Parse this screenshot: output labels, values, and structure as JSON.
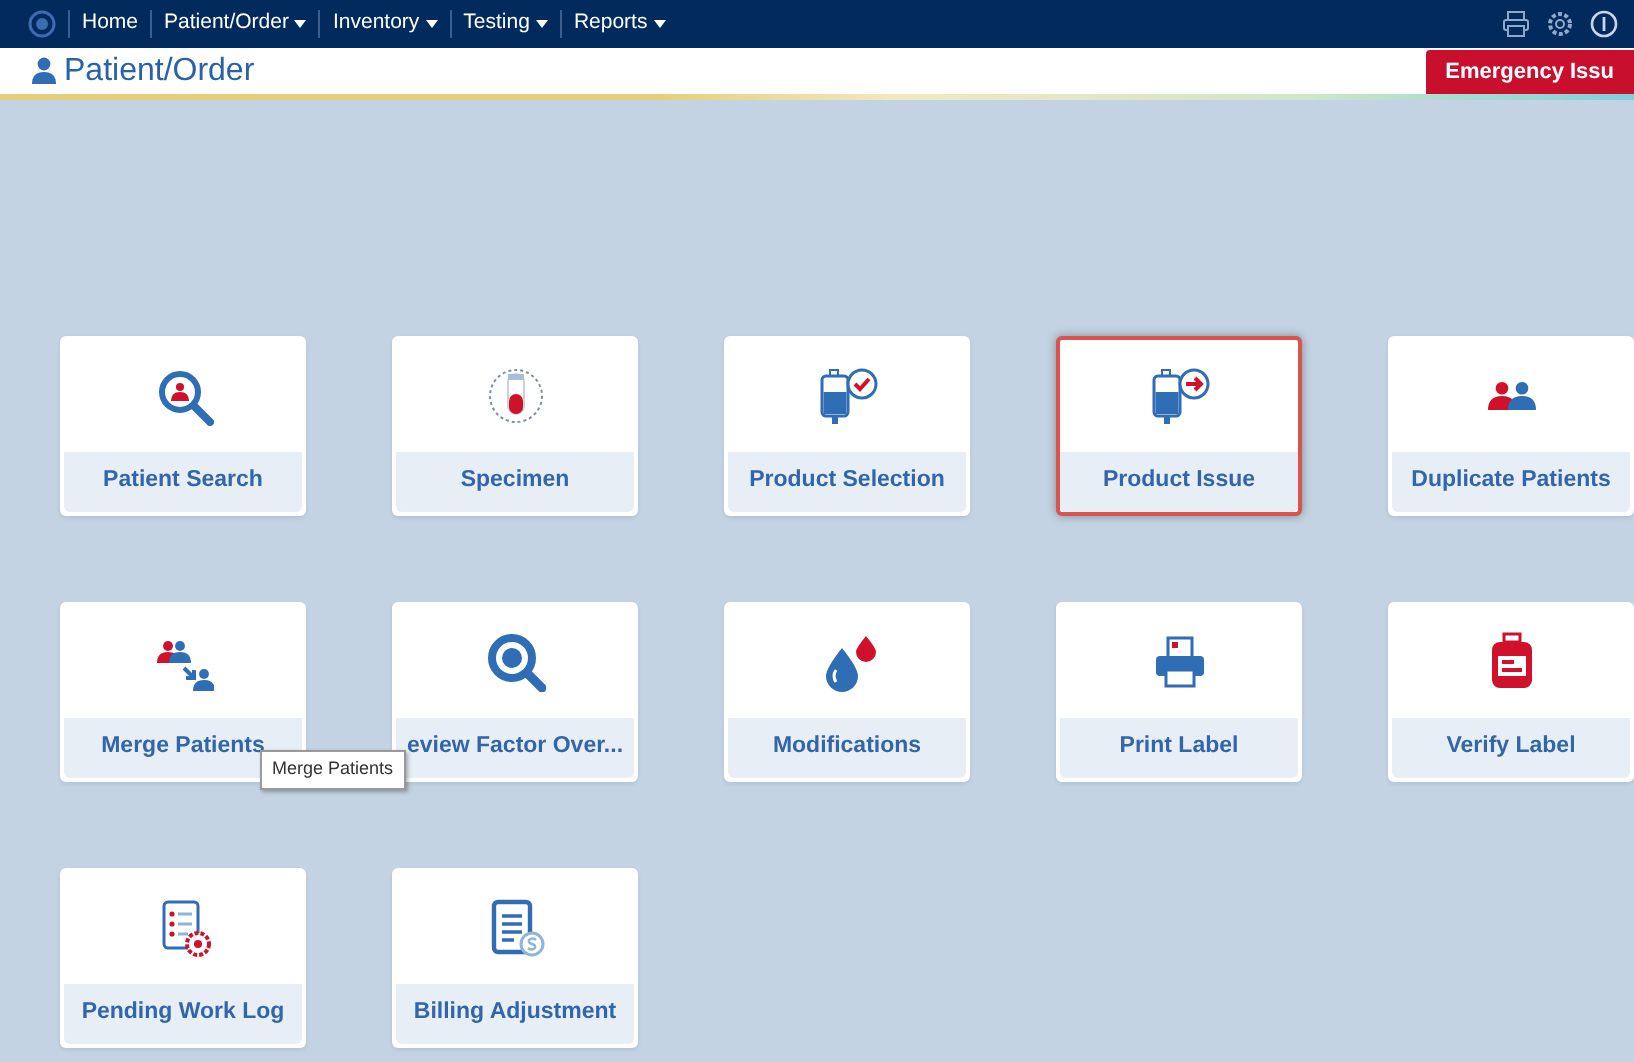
{
  "nav": [
    {
      "label": "Home",
      "dropdown": false
    },
    {
      "label": "Patient/Order",
      "dropdown": true
    },
    {
      "label": "Inventory",
      "dropdown": true
    },
    {
      "label": "Testing",
      "dropdown": true
    },
    {
      "label": "Reports",
      "dropdown": true
    }
  ],
  "page_title": "Patient/Order",
  "emergency_button": "Emergency Issu",
  "tiles": [
    {
      "label": "Patient Search",
      "kind": "patient-search",
      "selected": false
    },
    {
      "label": "Specimen",
      "kind": "tube",
      "selected": false
    },
    {
      "label": "Product Selection",
      "kind": "bag-check",
      "selected": false
    },
    {
      "label": "Product Issue",
      "kind": "bag-arrow",
      "selected": true
    },
    {
      "label": "Duplicate Patients",
      "kind": "people",
      "selected": false
    },
    {
      "label": "Merge Patients",
      "kind": "merge",
      "selected": false
    },
    {
      "label": "eview Factor Over...",
      "kind": "magnifier",
      "selected": false
    },
    {
      "label": "Modifications",
      "kind": "drops",
      "selected": false
    },
    {
      "label": "Print Label",
      "kind": "printer",
      "selected": false
    },
    {
      "label": "Verify Label",
      "kind": "blood-bag",
      "selected": false
    },
    {
      "label": "Pending Work Log",
      "kind": "list-gear",
      "selected": false
    },
    {
      "label": "Billing Adjustment",
      "kind": "document-dollar",
      "selected": false
    }
  ],
  "tooltip": "Merge Patients"
}
